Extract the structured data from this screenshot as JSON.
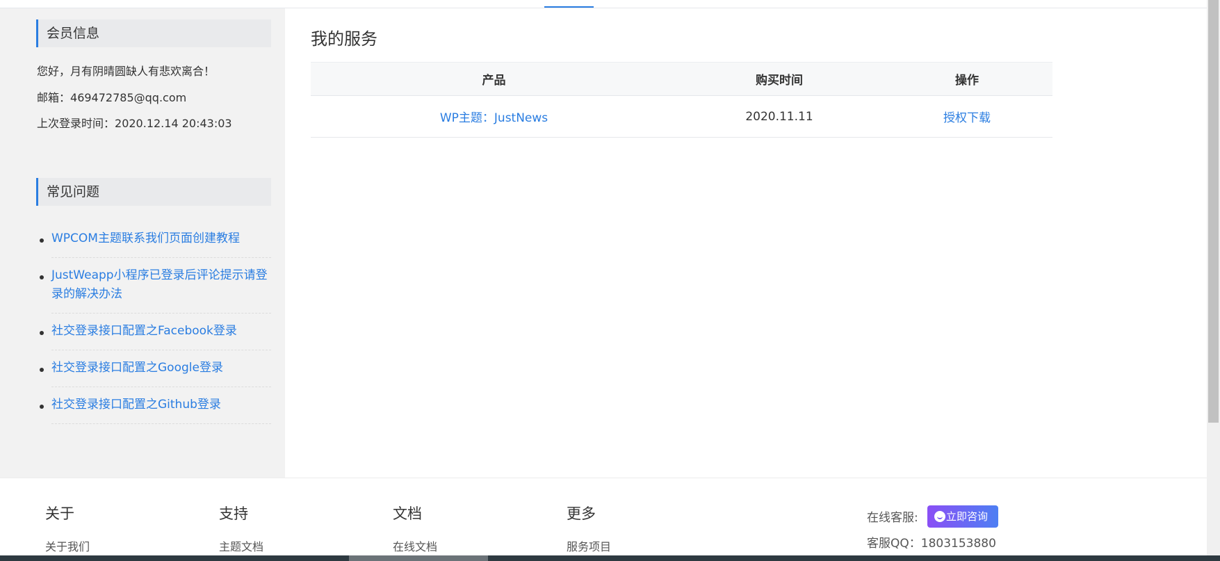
{
  "sidebar": {
    "member_heading": "会员信息",
    "greeting": "您好，月有阴晴圆缺人有悲欢离合！",
    "email_label": "邮箱：",
    "email_value": "469472785@qq.com",
    "last_login_label": "上次登录时间：",
    "last_login_value": "2020.12.14 20:43:03",
    "faq_heading": "常见问题",
    "faq_items": [
      {
        "label": "WPCOM主题联系我们页面创建教程"
      },
      {
        "label": "JustWeapp小程序已登录后评论提示请登录的解决办法"
      },
      {
        "label": "社交登录接口配置之Facebook登录"
      },
      {
        "label": "社交登录接口配置之Google登录"
      },
      {
        "label": "社交登录接口配置之Github登录"
      }
    ]
  },
  "main": {
    "title": "我的服务",
    "table": {
      "headers": [
        "产品",
        "购买时间",
        "操作"
      ],
      "rows": [
        {
          "product": "WP主题：JustNews",
          "purchase_time": "2020.11.11",
          "action": "授权下载"
        }
      ]
    }
  },
  "footer": {
    "columns": [
      {
        "title": "关于",
        "link": "关于我们"
      },
      {
        "title": "支持",
        "link": "主题文档"
      },
      {
        "title": "文档",
        "link": "在线文档"
      },
      {
        "title": "更多",
        "link": "服务项目"
      }
    ],
    "online_service_label": "在线客服:",
    "consult_button": "立即咨询",
    "qq_label": "客服QQ：",
    "qq_value": "1803153880"
  },
  "colors": {
    "accent": "#2a7de1",
    "sidebar_bg": "#f2f2f2",
    "consult_gradient_start": "#8a4ff5",
    "consult_gradient_end": "#4d7ff3"
  }
}
